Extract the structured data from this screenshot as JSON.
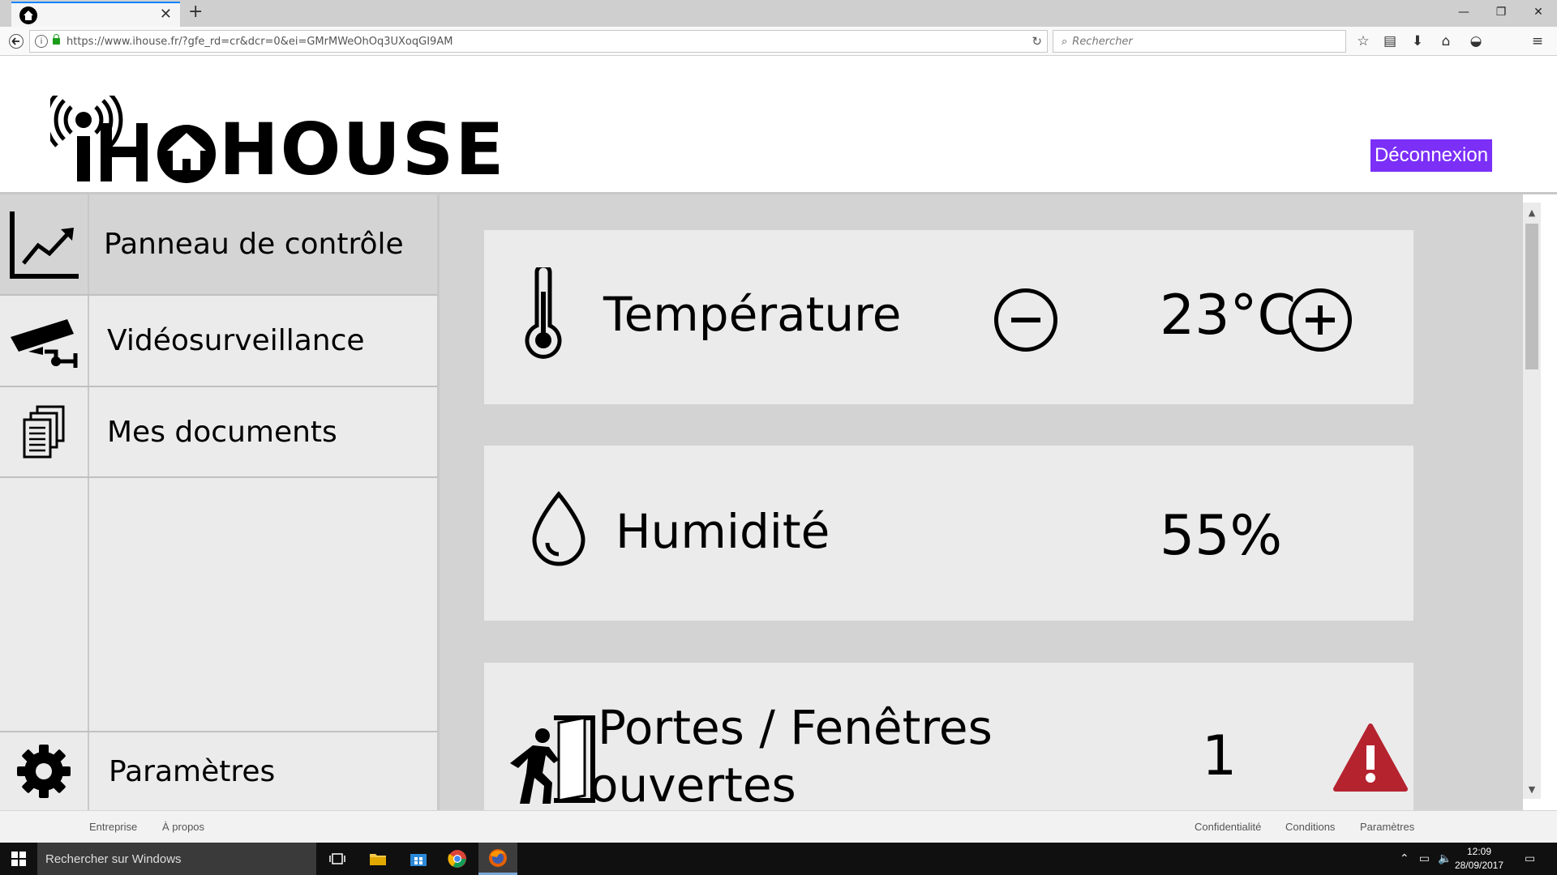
{
  "browser": {
    "tab_close": "✕",
    "new_tab": "+",
    "url": "https://www.ihouse.fr/?gfe_rd=cr&dcr=0&ei=GMrMWeOhOq3UXoqGI9AM",
    "search_placeholder": "Rechercher"
  },
  "header": {
    "logo_text": "HOUSE",
    "logout_label": "Déconnexion",
    "accent": "#7b2ff7"
  },
  "sidebar": {
    "items": [
      {
        "label": "Panneau de contrôle",
        "icon": "chart-line-icon",
        "active": true
      },
      {
        "label": "Vidéosurveillance",
        "icon": "camera-icon",
        "active": false
      },
      {
        "label": "Mes documents",
        "icon": "documents-icon",
        "active": false
      }
    ],
    "settings_label": "Paramètres"
  },
  "cards": {
    "temperature": {
      "title": "Température",
      "value": "23°C"
    },
    "humidity": {
      "title": "Humidité",
      "value": "55%"
    },
    "openings": {
      "title_line1": "Portes / Fenêtres",
      "title_line2": "ouvertes",
      "value": "1",
      "alert_color": "#b5232f"
    }
  },
  "footer": {
    "left": [
      "Entreprise",
      "À propos"
    ],
    "right": [
      "Confidentialité",
      "Conditions",
      "Paramètres"
    ]
  },
  "taskbar": {
    "search_placeholder": "Rechercher sur Windows",
    "time": "12:09",
    "date": "28/09/2017"
  }
}
